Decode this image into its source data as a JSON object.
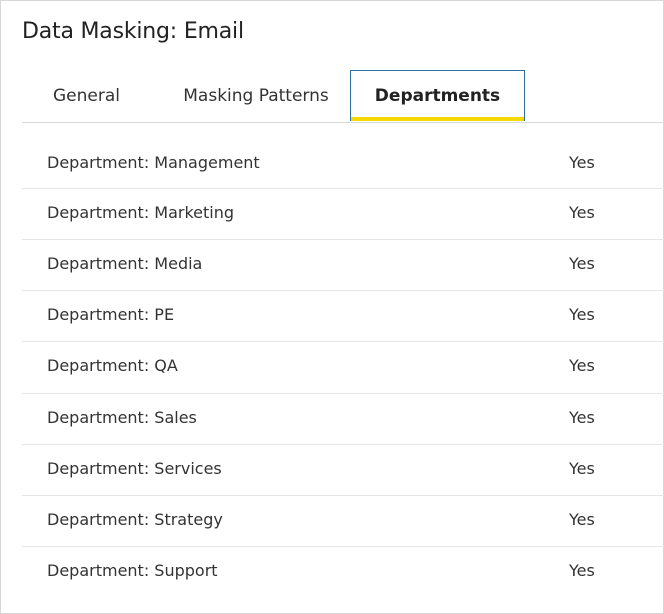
{
  "header": {
    "title": "Data Masking: Email"
  },
  "tabs": [
    {
      "label": "General",
      "active": false
    },
    {
      "label": "Masking Patterns",
      "active": false
    },
    {
      "label": "Departments",
      "active": true
    }
  ],
  "colors": {
    "active_tab_border": "#2d6ea3",
    "active_tab_underline": "#f5d800"
  },
  "departments": [
    {
      "name": "Department: Management",
      "value": "Yes"
    },
    {
      "name": "Department: Marketing",
      "value": "Yes"
    },
    {
      "name": "Department: Media",
      "value": "Yes"
    },
    {
      "name": "Department: PE",
      "value": "Yes"
    },
    {
      "name": "Department: QA",
      "value": "Yes"
    },
    {
      "name": "Department: Sales",
      "value": "Yes"
    },
    {
      "name": "Department: Services",
      "value": "Yes"
    },
    {
      "name": "Department: Strategy",
      "value": "Yes"
    },
    {
      "name": "Department: Support",
      "value": "Yes"
    }
  ]
}
